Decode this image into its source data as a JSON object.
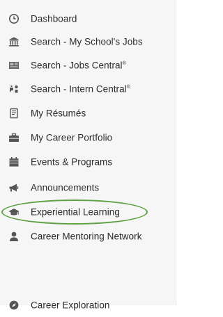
{
  "nav": {
    "items": [
      {
        "label": "Dashboard",
        "icon": "clock-icon"
      },
      {
        "label": "Search - My School's Jobs",
        "icon": "institution-icon"
      },
      {
        "label": "Search - Jobs Central",
        "sup": "®",
        "icon": "newspaper-icon"
      },
      {
        "label": "Search - Intern Central",
        "sup": "®",
        "icon": "gamepad-icon"
      },
      {
        "label": "My Résumés",
        "icon": "document-icon"
      },
      {
        "label": "My Career Portfolio",
        "icon": "briefcase-icon"
      },
      {
        "label": "Events & Programs",
        "icon": "calendar-icon"
      },
      {
        "label": "Announcements",
        "icon": "bullhorn-icon"
      },
      {
        "label": "Experiential Learning",
        "icon": "graduation-cap-icon"
      },
      {
        "label": "Career Mentoring Network",
        "icon": "user-icon"
      },
      {
        "label": "Career Exploration",
        "icon": "compass-icon"
      }
    ],
    "highlight_color": "#5da142",
    "icon_color": "#555555",
    "text_color": "#2b2b2b"
  }
}
